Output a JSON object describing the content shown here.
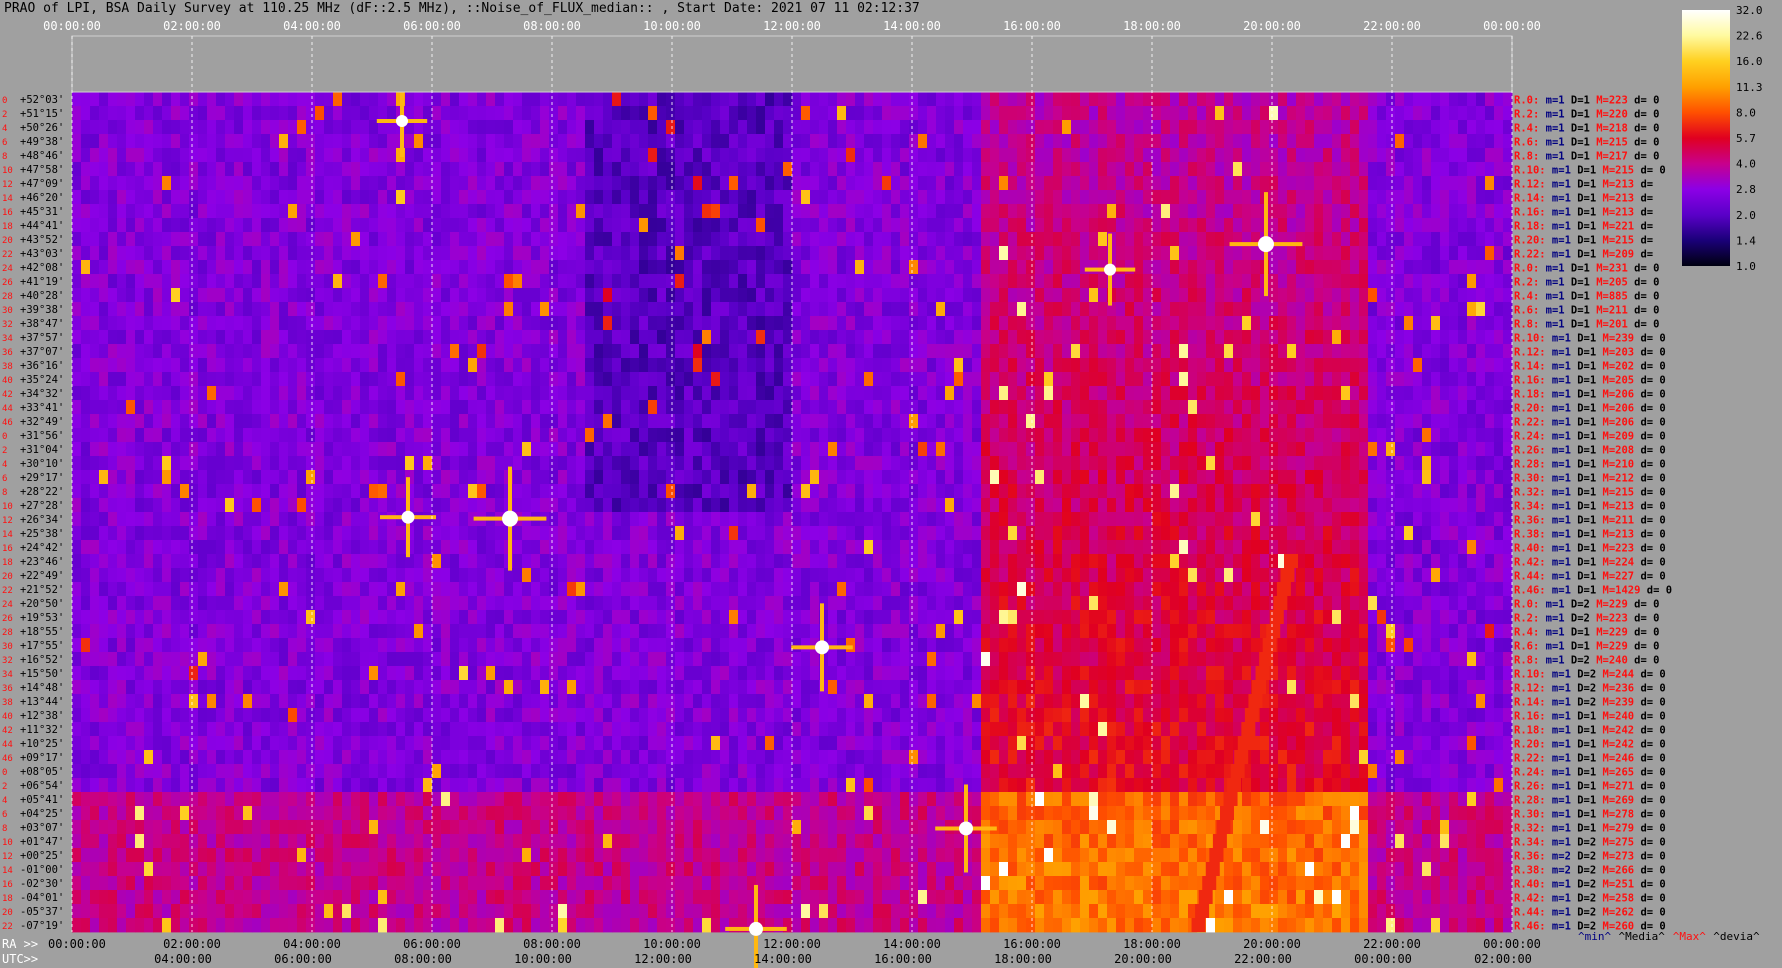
{
  "title": "PRAO of LPI, BSA Daily Survey at 110.25 MHz (dF::2.5 MHz), ::Noise_of_FLUX_median:: , Start Date: 2021 07 11 02:12:37",
  "chart_data": {
    "type": "heatmap",
    "title": "PRAO of LPI, BSA Daily Survey at 110.25 MHz (dF::2.5 MHz), ::Noise_of_FLUX_median:: , Start Date: 2021 07 11 02:12:37",
    "top_time_ticks": [
      "00:00:00",
      "02:00:00",
      "04:00:00",
      "06:00:00",
      "08:00:00",
      "10:00:00",
      "12:00:00",
      "14:00:00",
      "16:00:00",
      "18:00:00",
      "20:00:00",
      "22:00:00",
      "00:00:00"
    ],
    "ra_prefix": "RA >>",
    "ra_ticks": [
      "00:00:00",
      "02:00:00",
      "04:00:00",
      "06:00:00",
      "08:00:00",
      "10:00:00",
      "12:00:00",
      "14:00:00",
      "16:00:00",
      "18:00:00",
      "20:00:00",
      "22:00:00",
      "00:00:00"
    ],
    "utc_prefix": "UTC>>",
    "utc_ticks": [
      "04:00:00",
      "06:00:00",
      "08:00:00",
      "10:00:00",
      "12:00:00",
      "14:00:00",
      "16:00:00",
      "18:00:00",
      "20:00:00",
      "22:00:00",
      "00:00:00",
      "02:00:00"
    ],
    "declinations": [
      "+52°03'",
      "+51°15'",
      "+50°26'",
      "+49°38'",
      "+48°46'",
      "+47°58'",
      "+47°09'",
      "+46°20'",
      "+45°31'",
      "+44°41'",
      "+43°52'",
      "+43°03'",
      "+42°08'",
      "+41°19'",
      "+40°28'",
      "+39°38'",
      "+38°47'",
      "+37°57'",
      "+37°07'",
      "+36°16'",
      "+35°24'",
      "+34°32'",
      "+33°41'",
      "+32°49'",
      "+31°56'",
      "+31°04'",
      "+30°10'",
      "+29°17'",
      "+28°22'",
      "+27°28'",
      "+26°34'",
      "+25°38'",
      "+24°42'",
      "+23°46'",
      "+22°49'",
      "+21°52'",
      "+20°50'",
      "+19°53'",
      "+18°55'",
      "+17°55'",
      "+16°52'",
      "+15°50'",
      "+14°48'",
      "+13°44'",
      "+12°38'",
      "+11°32'",
      "+10°25'",
      "+09°17'",
      "+08°05'",
      "+06°54'",
      "+05°41'",
      "+04°25'",
      "+03°07'",
      "+01°47'",
      "+00°25'",
      "-01°00'",
      "-02°30'",
      "-04°01'",
      "-05°37'",
      "-07°19'"
    ],
    "beam_index_labels": [
      "0",
      "2",
      "4",
      "6",
      "8",
      "10",
      "12",
      "14",
      "16",
      "18",
      "20",
      "22",
      "24",
      "26",
      "28",
      "30",
      "32",
      "34",
      "36",
      "38",
      "40",
      "42",
      "44",
      "46"
    ],
    "row_stats": [
      {
        "r": "R.0:",
        "m": "1",
        "D": "1",
        "M": "223",
        "d": "0"
      },
      {
        "r": "R.2:",
        "m": "1",
        "D": "1",
        "M": "220",
        "d": "0"
      },
      {
        "r": "R.4:",
        "m": "1",
        "D": "1",
        "M": "218",
        "d": "0"
      },
      {
        "r": "R.6:",
        "m": "1",
        "D": "1",
        "M": "215",
        "d": "0"
      },
      {
        "r": "R.8:",
        "m": "1",
        "D": "1",
        "M": "217",
        "d": "0"
      },
      {
        "r": "R.10:",
        "m": "1",
        "D": "1",
        "M": "215",
        "d": "0"
      },
      {
        "r": "R.12:",
        "m": "1",
        "D": "1",
        "M": "213",
        "d": ""
      },
      {
        "r": "R.14:",
        "m": "1",
        "D": "1",
        "M": "213",
        "d": ""
      },
      {
        "r": "R.16:",
        "m": "1",
        "D": "1",
        "M": "213",
        "d": ""
      },
      {
        "r": "R.18:",
        "m": "1",
        "D": "1",
        "M": "221",
        "d": ""
      },
      {
        "r": "R.20:",
        "m": "1",
        "D": "1",
        "M": "215",
        "d": ""
      },
      {
        "r": "R.22:",
        "m": "1",
        "D": "1",
        "M": "209",
        "d": ""
      },
      {
        "r": "R.0:",
        "m": "1",
        "D": "1",
        "M": "231",
        "d": "0"
      },
      {
        "r": "R.2:",
        "m": "1",
        "D": "1",
        "M": "205",
        "d": "0"
      },
      {
        "r": "R.4:",
        "m": "1",
        "D": "1",
        "M": "885",
        "d": "0"
      },
      {
        "r": "R.6:",
        "m": "1",
        "D": "1",
        "M": "211",
        "d": "0"
      },
      {
        "r": "R.8:",
        "m": "1",
        "D": "1",
        "M": "201",
        "d": "0"
      },
      {
        "r": "R.10:",
        "m": "1",
        "D": "1",
        "M": "239",
        "d": "0"
      },
      {
        "r": "R.12:",
        "m": "1",
        "D": "1",
        "M": "203",
        "d": "0"
      },
      {
        "r": "R.14:",
        "m": "1",
        "D": "1",
        "M": "202",
        "d": "0"
      },
      {
        "r": "R.16:",
        "m": "1",
        "D": "1",
        "M": "205",
        "d": "0"
      },
      {
        "r": "R.18:",
        "m": "1",
        "D": "1",
        "M": "206",
        "d": "0"
      },
      {
        "r": "R.20:",
        "m": "1",
        "D": "1",
        "M": "206",
        "d": "0"
      },
      {
        "r": "R.22:",
        "m": "1",
        "D": "1",
        "M": "206",
        "d": "0"
      },
      {
        "r": "R.24:",
        "m": "1",
        "D": "1",
        "M": "209",
        "d": "0"
      },
      {
        "r": "R.26:",
        "m": "1",
        "D": "1",
        "M": "208",
        "d": "0"
      },
      {
        "r": "R.28:",
        "m": "1",
        "D": "1",
        "M": "210",
        "d": "0"
      },
      {
        "r": "R.30:",
        "m": "1",
        "D": "1",
        "M": "212",
        "d": "0"
      },
      {
        "r": "R.32:",
        "m": "1",
        "D": "1",
        "M": "215",
        "d": "0"
      },
      {
        "r": "R.34:",
        "m": "1",
        "D": "1",
        "M": "213",
        "d": "0"
      },
      {
        "r": "R.36:",
        "m": "1",
        "D": "1",
        "M": "211",
        "d": "0"
      },
      {
        "r": "R.38:",
        "m": "1",
        "D": "1",
        "M": "213",
        "d": "0"
      },
      {
        "r": "R.40:",
        "m": "1",
        "D": "1",
        "M": "223",
        "d": "0"
      },
      {
        "r": "R.42:",
        "m": "1",
        "D": "1",
        "M": "224",
        "d": "0"
      },
      {
        "r": "R.44:",
        "m": "1",
        "D": "1",
        "M": "227",
        "d": "0"
      },
      {
        "r": "R.46:",
        "m": "1",
        "D": "1",
        "M": "1429",
        "d": "0"
      },
      {
        "r": "R.0:",
        "m": "1",
        "D": "2",
        "M": "229",
        "d": "0"
      },
      {
        "r": "R.2:",
        "m": "1",
        "D": "2",
        "M": "223",
        "d": "0"
      },
      {
        "r": "R.4:",
        "m": "1",
        "D": "1",
        "M": "229",
        "d": "0"
      },
      {
        "r": "R.6:",
        "m": "1",
        "D": "1",
        "M": "229",
        "d": "0"
      },
      {
        "r": "R.8:",
        "m": "1",
        "D": "2",
        "M": "240",
        "d": "0"
      },
      {
        "r": "R.10:",
        "m": "1",
        "D": "2",
        "M": "244",
        "d": "0"
      },
      {
        "r": "R.12:",
        "m": "1",
        "D": "2",
        "M": "236",
        "d": "0"
      },
      {
        "r": "R.14:",
        "m": "1",
        "D": "2",
        "M": "239",
        "d": "0"
      },
      {
        "r": "R.16:",
        "m": "1",
        "D": "1",
        "M": "240",
        "d": "0"
      },
      {
        "r": "R.18:",
        "m": "1",
        "D": "1",
        "M": "242",
        "d": "0"
      },
      {
        "r": "R.20:",
        "m": "1",
        "D": "1",
        "M": "242",
        "d": "0"
      },
      {
        "r": "R.22:",
        "m": "1",
        "D": "1",
        "M": "246",
        "d": "0"
      },
      {
        "r": "R.24:",
        "m": "1",
        "D": "1",
        "M": "265",
        "d": "0"
      },
      {
        "r": "R.26:",
        "m": "1",
        "D": "1",
        "M": "271",
        "d": "0"
      },
      {
        "r": "R.28:",
        "m": "1",
        "D": "1",
        "M": "269",
        "d": "0"
      },
      {
        "r": "R.30:",
        "m": "1",
        "D": "1",
        "M": "278",
        "d": "0"
      },
      {
        "r": "R.32:",
        "m": "1",
        "D": "1",
        "M": "279",
        "d": "0"
      },
      {
        "r": "R.34:",
        "m": "1",
        "D": "2",
        "M": "275",
        "d": "0"
      },
      {
        "r": "R.36:",
        "m": "2",
        "D": "2",
        "M": "273",
        "d": "0"
      },
      {
        "r": "R.38:",
        "m": "2",
        "D": "2",
        "M": "266",
        "d": "0"
      },
      {
        "r": "R.40:",
        "m": "1",
        "D": "2",
        "M": "251",
        "d": "0"
      },
      {
        "r": "R.42:",
        "m": "1",
        "D": "2",
        "M": "258",
        "d": "0"
      },
      {
        "r": "R.44:",
        "m": "1",
        "D": "2",
        "M": "262",
        "d": "0"
      },
      {
        "r": "R.46:",
        "m": "1",
        "D": "2",
        "M": "260",
        "d": "0"
      }
    ],
    "stat_legend": [
      "^min^",
      "^Media^",
      "^Max^",
      "^devia^"
    ],
    "colorbar": {
      "ticks": [
        "32.0",
        "22.6",
        "16.0",
        "11.3",
        "8.0",
        "5.7",
        "4.0",
        "2.8",
        "2.0",
        "1.4",
        "1.0"
      ],
      "stops": [
        "#ffffff",
        "#fffaa0",
        "#ffd020",
        "#ffa000",
        "#ff5000",
        "#e00020",
        "#c8008c",
        "#8c00e6",
        "#5a00c8",
        "#1a0078",
        "#000010"
      ]
    },
    "sources": [
      {
        "ra_h": 7.3,
        "dec": 21.9,
        "brightness": 1.0
      },
      {
        "ra_h": 19.9,
        "dec": 41.3,
        "brightness": 1.0
      },
      {
        "ra_h": 12.5,
        "dec": 12.8,
        "brightness": 0.8
      },
      {
        "ra_h": 11.4,
        "dec": -7.1,
        "brightness": 0.8
      },
      {
        "ra_h": 5.6,
        "dec": 22.0,
        "brightness": 0.7
      },
      {
        "ra_h": 14.9,
        "dec": 0.0,
        "brightness": 0.8
      },
      {
        "ra_h": 5.5,
        "dec": 50.0,
        "brightness": 0.6
      },
      {
        "ra_h": 17.3,
        "dec": 39.5,
        "brightness": 0.6
      }
    ]
  }
}
